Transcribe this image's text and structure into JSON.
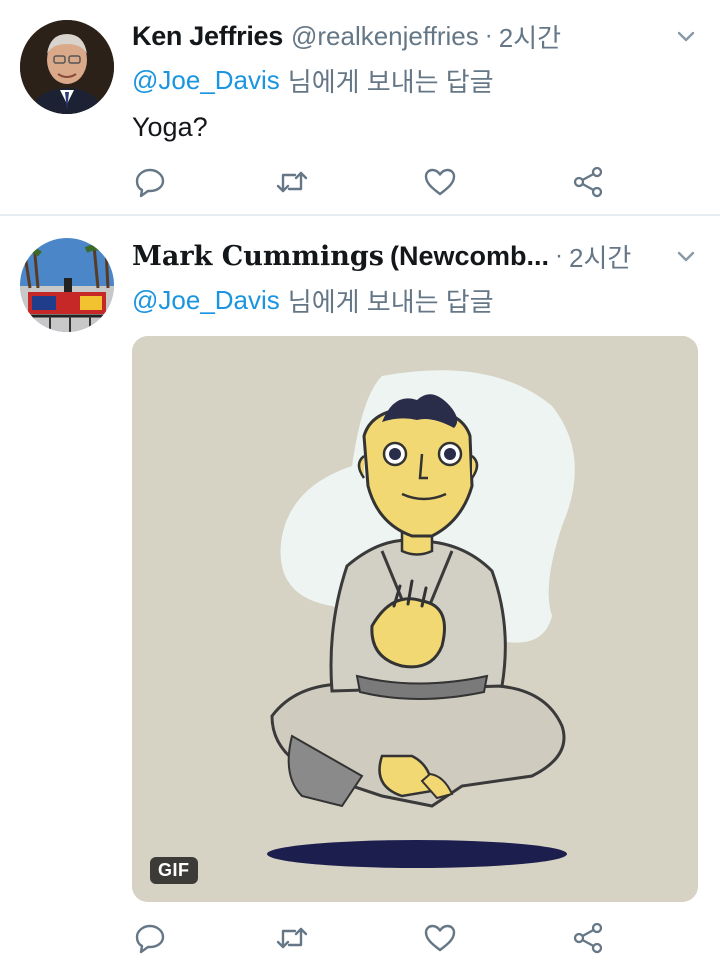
{
  "tweets": [
    {
      "author_name": "Ken Jeffries",
      "author_handle": "@realkenjeffries",
      "separator": "·",
      "time": "2시간",
      "reply_mention": "@Joe_Davis",
      "reply_suffix": "님에게 보내는 답글",
      "text": "Yoga?"
    },
    {
      "author_name_styled": "Mark Cummings",
      "author_name_rest": "(Newcomb...",
      "separator": "·",
      "time": "2시간",
      "reply_mention": "@Joe_Davis",
      "reply_suffix": "님에게 보내는 답글",
      "media_badge": "GIF"
    }
  ],
  "icons": [
    "reply-icon",
    "retweet-icon",
    "like-icon",
    "share-icon",
    "chevron-down-icon"
  ],
  "colors": {
    "link": "#1b95e0",
    "muted": "#657786",
    "text": "#14171a",
    "divider": "#e6ecf0"
  }
}
